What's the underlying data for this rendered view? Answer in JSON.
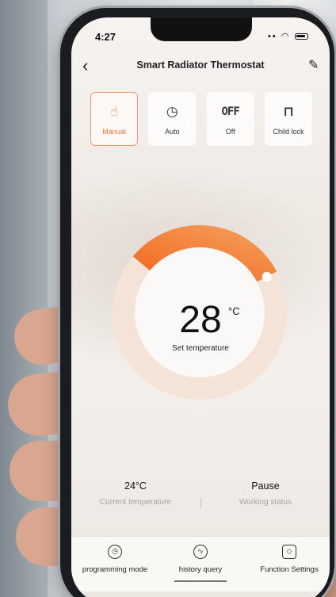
{
  "status_bar": {
    "time": "4:27",
    "signal_icon": "signal-icon",
    "wifi_icon": "wifi-icon",
    "battery_icon": "battery-icon"
  },
  "header": {
    "title": "Smart Radiator Thermostat",
    "back_icon": "chevron-left-icon",
    "edit_icon": "pencil-icon"
  },
  "modes": [
    {
      "label": "Manual",
      "icon": "hand-pointer-icon",
      "active": true
    },
    {
      "label": "Auto",
      "icon": "clock-icon",
      "active": false
    },
    {
      "label": "Off",
      "icon_text": "OFF",
      "active": false
    },
    {
      "label": "Child lock",
      "icon": "lock-icon",
      "active": false
    }
  ],
  "dial": {
    "value": "28",
    "unit": "°C",
    "caption": "Set temperature",
    "accent": "#f07a2c",
    "fill_fraction": 0.4
  },
  "stats": {
    "current": {
      "value": "24°C",
      "label": "Current temperature"
    },
    "working": {
      "value": "Pause",
      "label": "Working status"
    }
  },
  "bottom_tabs": [
    {
      "label": "programming mode",
      "icon": "clock-icon"
    },
    {
      "label": "history query",
      "icon": "chart-wave-icon"
    },
    {
      "label": "Function Settings",
      "icon": "cube-icon"
    }
  ]
}
